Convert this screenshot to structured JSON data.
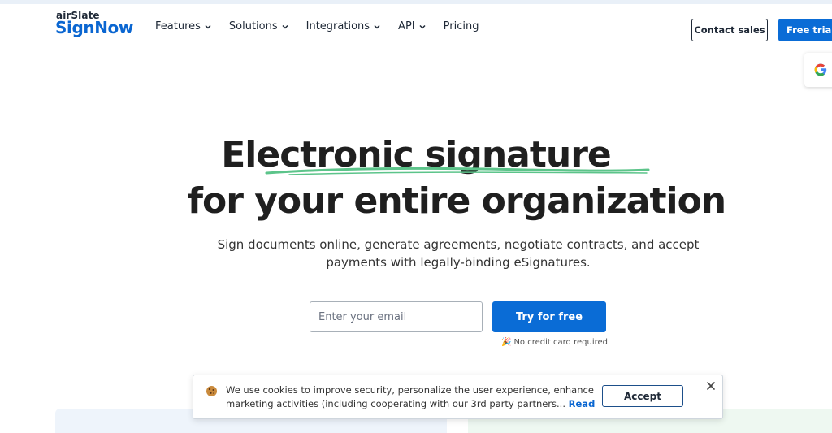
{
  "header": {
    "logo_top": "airSlate",
    "logo_main": "SignNow",
    "nav": [
      {
        "label": "Features",
        "icon": "chevron-down-icon"
      },
      {
        "label": "Solutions",
        "icon": "chevron-down-icon"
      },
      {
        "label": "Integrations",
        "icon": "chevron-down-icon"
      },
      {
        "label": "API",
        "icon": "chevron-down-icon"
      },
      {
        "label": "Pricing"
      }
    ],
    "contact_sales": "Contact sales",
    "free_trial": "Free trial"
  },
  "hero": {
    "title_line1": "Electronic signature",
    "title_line2": "for your entire organization",
    "subtitle_line1": "Sign documents online, generate agreements, negotiate contracts, and accept",
    "subtitle_line2": "payments with legally-binding eSignatures.",
    "email_placeholder": "Enter your email",
    "cta": "Try for free",
    "no_card": "No credit card required",
    "underline_color": "#5cc48a"
  },
  "cookie": {
    "line1": "We use cookies to improve security, personalize the user experience, enhance our",
    "line2": "marketing activities (including cooperating with our 3rd party partners...",
    "read_more": "Read more...",
    "accept": "Accept"
  },
  "colors": {
    "brand_blue": "#0a6cd6",
    "text_dark": "#1f1f1f"
  }
}
